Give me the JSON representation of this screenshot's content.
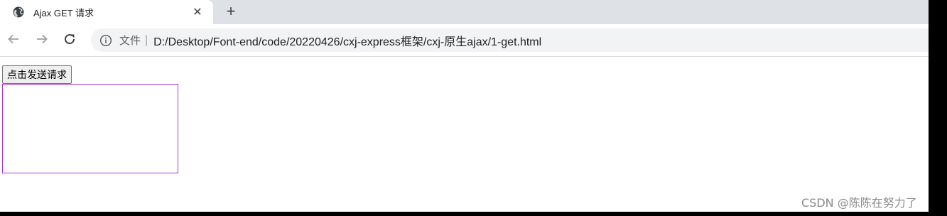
{
  "tab": {
    "title": "Ajax GET 请求",
    "favicon": "globe-icon",
    "close_glyph": "✕",
    "new_tab_glyph": "+"
  },
  "toolbar": {
    "back_icon": "arrow-left-icon",
    "forward_icon": "arrow-right-icon",
    "reload_icon": "reload-icon",
    "info_icon": "info-icon",
    "scheme_label": "文件",
    "divider": "|",
    "url": "D:/Desktop/Font-end/code/20220426/cxj-express框架/cxj-原生ajax/1-get.html"
  },
  "page": {
    "send_button_label": "点击发送请求",
    "result_text": "",
    "result_border_color": "#b030d0"
  },
  "watermark": "CSDN @陈陈在努力了"
}
